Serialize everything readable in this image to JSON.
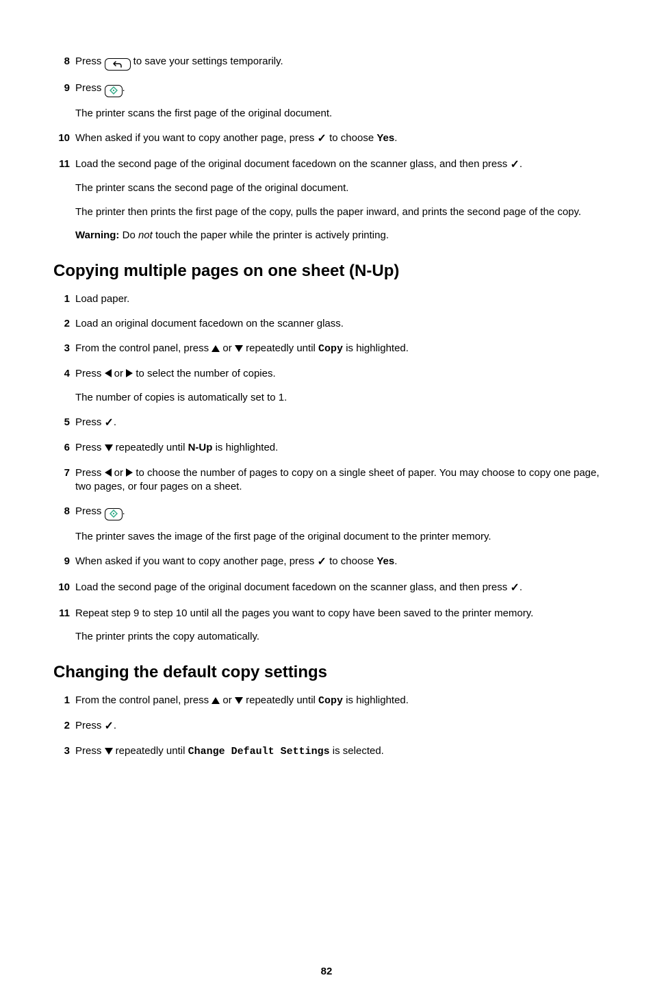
{
  "section0": {
    "steps": [
      {
        "n": "8",
        "pieces": [
          "Press ",
          {
            "icon": "undo-button"
          },
          " to save your settings temporarily."
        ]
      },
      {
        "n": "9",
        "pieces": [
          "Press ",
          {
            "icon": "start-button"
          },
          "."
        ],
        "after": [
          "The printer scans the first page of the original document."
        ]
      },
      {
        "n": "10",
        "pieces": [
          "When asked if you want to copy another page, press ",
          {
            "icon": "check"
          },
          " to choose ",
          {
            "b": "Yes"
          },
          "."
        ]
      },
      {
        "n": "11",
        "pieces": [
          "Load the second page of the original document facedown on the scanner glass, and then press ",
          {
            "icon": "check"
          },
          "."
        ],
        "after": [
          "The printer scans the second page of the original document.",
          "The printer then prints the first page of the copy, pulls the paper inward, and prints the second page of the copy."
        ],
        "warning": {
          "label": "Warning:",
          "pre": " Do ",
          "i": "not",
          "post": " touch the paper while the printer is actively printing."
        }
      }
    ]
  },
  "section1": {
    "heading": "Copying multiple pages on one sheet (N-Up)",
    "steps": [
      {
        "n": "1",
        "pieces": [
          "Load paper."
        ]
      },
      {
        "n": "2",
        "pieces": [
          "Load an original document facedown on the scanner glass."
        ]
      },
      {
        "n": "3",
        "pieces": [
          "From the control panel, press ",
          {
            "icon": "up"
          },
          " or ",
          {
            "icon": "down"
          },
          " repeatedly until ",
          {
            "m": "Copy"
          },
          " is highlighted."
        ]
      },
      {
        "n": "4",
        "pieces": [
          "Press ",
          {
            "icon": "left"
          },
          " or ",
          {
            "icon": "right"
          },
          " to select the number of copies."
        ],
        "after": [
          "The number of copies is automatically set to 1."
        ]
      },
      {
        "n": "5",
        "pieces": [
          "Press ",
          {
            "icon": "check"
          },
          "."
        ]
      },
      {
        "n": "6",
        "pieces": [
          "Press ",
          {
            "icon": "down"
          },
          " repeatedly until ",
          {
            "b": "N-Up"
          },
          " is highlighted."
        ]
      },
      {
        "n": "7",
        "pieces": [
          "Press ",
          {
            "icon": "left"
          },
          " or ",
          {
            "icon": "right"
          },
          " to choose the number of pages to copy on a single sheet of paper. You may choose to copy one page, two pages, or four pages on a sheet."
        ]
      },
      {
        "n": "8",
        "pieces": [
          "Press ",
          {
            "icon": "start-button"
          },
          "."
        ],
        "after": [
          "The printer saves the image of the first page of the original document to the printer memory."
        ]
      },
      {
        "n": "9",
        "pieces": [
          "When asked if you want to copy another page, press ",
          {
            "icon": "check"
          },
          " to choose ",
          {
            "b": "Yes"
          },
          "."
        ]
      },
      {
        "n": "10",
        "pieces": [
          "Load the second page of the original document facedown on the scanner glass, and then press ",
          {
            "icon": "check"
          },
          "."
        ]
      },
      {
        "n": "11",
        "pieces": [
          "Repeat step 9 to step 10 until all the pages you want to copy have been saved to the printer memory."
        ],
        "after": [
          "The printer prints the copy automatically."
        ]
      }
    ]
  },
  "section2": {
    "heading": "Changing the default copy settings",
    "steps": [
      {
        "n": "1",
        "pieces": [
          "From the control panel, press ",
          {
            "icon": "up"
          },
          " or ",
          {
            "icon": "down"
          },
          " repeatedly until ",
          {
            "m": "Copy"
          },
          " is highlighted."
        ]
      },
      {
        "n": "2",
        "pieces": [
          "Press ",
          {
            "icon": "check"
          },
          "."
        ]
      },
      {
        "n": "3",
        "pieces": [
          "Press ",
          {
            "icon": "down"
          },
          " repeatedly until ",
          {
            "m": "Change Default Settings"
          },
          " is selected."
        ]
      }
    ]
  },
  "pagenum": "82"
}
